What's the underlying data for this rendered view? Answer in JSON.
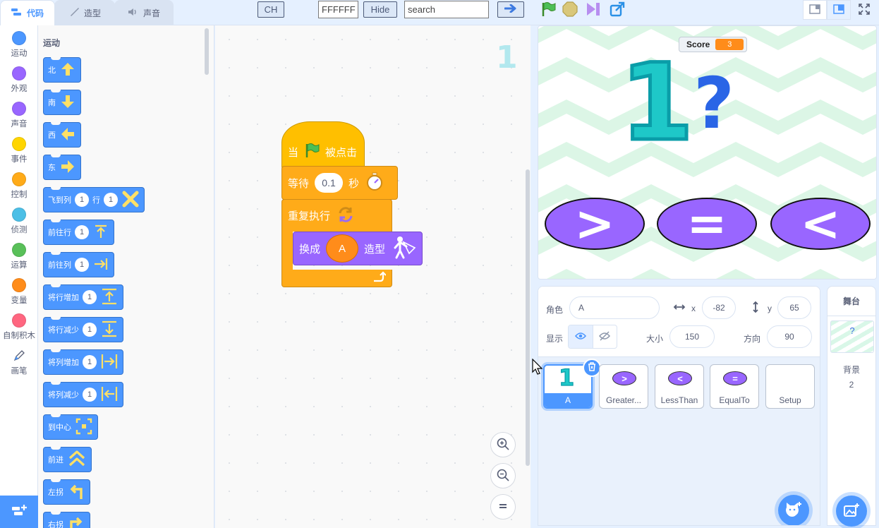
{
  "top_bar": {
    "tabs": [
      {
        "label": "代码",
        "icon": "code-icon",
        "active": true
      },
      {
        "label": "造型",
        "icon": "brush-icon",
        "active": false
      },
      {
        "label": "声音",
        "icon": "speaker-icon",
        "active": false
      }
    ],
    "ch_button": "CH",
    "color_input": "FFFFFF",
    "hide_button": "Hide",
    "search_placeholder": "search",
    "go_icon": "arrow-right-icon",
    "controls": [
      "green-flag-icon",
      "stop-icon",
      "pause-icon",
      "share-icon"
    ],
    "view_icons": [
      "small-stage-icon",
      "large-stage-icon",
      "fullscreen-icon"
    ]
  },
  "categories": [
    {
      "label": "运动",
      "color": "#4c97ff"
    },
    {
      "label": "外观",
      "color": "#9966ff"
    },
    {
      "label": "声音",
      "color": "#9966ff"
    },
    {
      "label": "事件",
      "color": "#ffd500"
    },
    {
      "label": "控制",
      "color": "#ffab19"
    },
    {
      "label": "侦测",
      "color": "#4cbfe6"
    },
    {
      "label": "运算",
      "color": "#59c059"
    },
    {
      "label": "变量",
      "color": "#ff8c1a"
    },
    {
      "label": "自制积木",
      "color": "#ff6680"
    },
    {
      "label": "画笔",
      "icon": "pen-icon"
    }
  ],
  "palette": {
    "title": "运动",
    "blocks": [
      {
        "label": "北",
        "icon": "arrow-up-icon"
      },
      {
        "label": "南",
        "icon": "arrow-down-icon"
      },
      {
        "label": "西",
        "icon": "arrow-left-icon"
      },
      {
        "label": "东",
        "icon": "arrow-right-icon"
      },
      {
        "label": "飞到列",
        "arg1": "1",
        "mid": "行",
        "arg2": "1",
        "icon": "cross-icon"
      },
      {
        "label": "前往行",
        "arg1": "1",
        "icon": "goto-row-icon"
      },
      {
        "label": "前往列",
        "arg1": "1",
        "icon": "goto-col-icon"
      },
      {
        "label": "将行增加",
        "arg1": "1",
        "icon": "row-up-icon"
      },
      {
        "label": "将行减少",
        "arg1": "1",
        "icon": "row-down-icon"
      },
      {
        "label": "将列增加",
        "arg1": "1",
        "icon": "col-right-icon"
      },
      {
        "label": "将列减少",
        "arg1": "1",
        "icon": "col-left-icon"
      },
      {
        "label": "到中心",
        "icon": "center-icon"
      },
      {
        "label": "前进",
        "icon": "chevrons-up-icon"
      },
      {
        "label": "左拐",
        "icon": "turn-left-icon"
      },
      {
        "label": "右拐",
        "icon": "turn-right-icon"
      }
    ]
  },
  "script": {
    "sprite_number": "1",
    "when_flag": {
      "pre": "当",
      "post": "被点击"
    },
    "wait": {
      "label": "等待",
      "value": "0.1",
      "unit": "秒"
    },
    "forever": {
      "label": "重复执行"
    },
    "switch_costume": {
      "pre": "换成",
      "value": "A",
      "post": "造型"
    }
  },
  "stage": {
    "score_label": "Score",
    "score_value": "3",
    "number": "1",
    "question": "?",
    "buttons": [
      ">",
      "=",
      "<"
    ]
  },
  "sprite_info": {
    "sprite_label": "角色",
    "sprite_name": "A",
    "x_label": "x",
    "x_value": "-82",
    "y_label": "y",
    "y_value": "65",
    "show_label": "显示",
    "size_label": "大小",
    "size_value": "150",
    "direction_label": "方向",
    "direction_value": "90"
  },
  "sprites": [
    {
      "name": "A",
      "thumb": "1",
      "selected": true
    },
    {
      "name": "Greater...",
      "thumb": ">",
      "selected": false
    },
    {
      "name": "LessThan",
      "thumb": "<",
      "selected": false
    },
    {
      "name": "EqualTo",
      "thumb": "=",
      "selected": false
    },
    {
      "name": "Setup",
      "thumb": "",
      "selected": false
    }
  ],
  "stage_panel": {
    "title": "舞台",
    "backdrop_label": "背景",
    "backdrop_count": "2",
    "thumb_text": "?"
  }
}
